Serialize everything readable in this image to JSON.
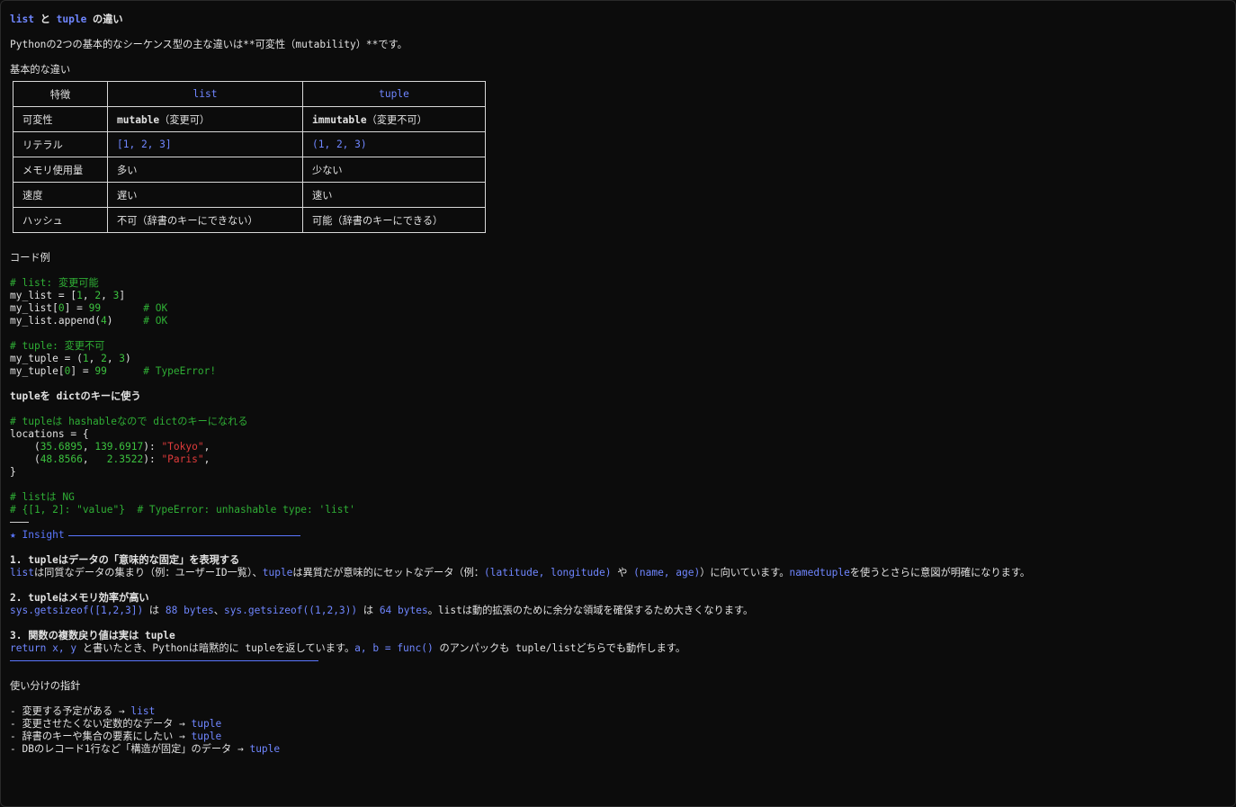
{
  "heading": {
    "list": "list",
    "and": " と ",
    "tuple": "tuple",
    "rest": " の違い"
  },
  "intro": "Pythonの2つの基本的なシーケンス型の主な違いは**可変性（mutability）**です。",
  "basic_title": "基本的な違い",
  "table": {
    "headers": [
      "特徴",
      "list",
      "tuple"
    ],
    "rows": [
      {
        "feature": "可変性",
        "list_bold": "mutable",
        "list_rest": "（変更可）",
        "tuple_bold": "immutable",
        "tuple_rest": "（変更不可）"
      },
      {
        "feature": "リテラル",
        "list": "[1, 2, 3]",
        "tuple": "(1, 2, 3)"
      },
      {
        "feature": "メモリ使用量",
        "list": "多い",
        "tuple": "少ない"
      },
      {
        "feature": "速度",
        "list": "遅い",
        "tuple": "速い"
      },
      {
        "feature": "ハッシュ",
        "list": "不可（辞書のキーにできない）",
        "tuple": "可能（辞書のキーにできる）"
      }
    ]
  },
  "code_example_title": "コード例",
  "code1": {
    "c1": "# list: 変更可能",
    "l1_a": "my_list = [",
    "l1_n1": "1",
    "l1_s1": ", ",
    "l1_n2": "2",
    "l1_s2": ", ",
    "l1_n3": "3",
    "l1_b": "]",
    "l2_a": "my_list[",
    "l2_n1": "0",
    "l2_b": "] = ",
    "l2_n2": "99",
    "l2_pad": "       ",
    "l2_c": "# OK",
    "l3_a": "my_list.append(",
    "l3_n": "4",
    "l3_b": ")",
    "l3_pad": "     ",
    "l3_c": "# OK",
    "c2": "# tuple: 変更不可",
    "l4_a": "my_tuple = (",
    "l4_n1": "1",
    "l4_s1": ", ",
    "l4_n2": "2",
    "l4_s2": ", ",
    "l4_n3": "3",
    "l4_b": ")",
    "l5_a": "my_tuple[",
    "l5_n1": "0",
    "l5_b": "] = ",
    "l5_n2": "99",
    "l5_pad": "      ",
    "l5_c": "# TypeError!"
  },
  "dict_key_title": "tupleを dictのキーに使う",
  "code2": {
    "c1": "# tupleは hashableなので dictのキーになれる",
    "l1": "locations = {",
    "l2_a": "    (",
    "l2_n1": "35.6895",
    "l2_s": ", ",
    "l2_n2": "139.6917",
    "l2_b": "): ",
    "l2_str": "\"Tokyo\"",
    "l2_e": ",",
    "l3_a": "    (",
    "l3_n1": "48.8566",
    "l3_s": ",   ",
    "l3_n2": "2.3522",
    "l3_b": "): ",
    "l3_str": "\"Paris\"",
    "l3_e": ",",
    "l4": "}",
    "c2": "# listは NG",
    "c3": "# {[1, 2]: \"value\"}  # TypeError: unhashable type: 'list'"
  },
  "separator": "---",
  "insight": {
    "title": "★ Insight",
    "p1_title": "1. tupleはデータの「意味的な固定」を表現する",
    "p1_k1": "list",
    "p1_t1": "は同質なデータの集まり（例：ユーザーID一覧）、",
    "p1_k2": "tuple",
    "p1_t2": "は異質だが意味的にセットなデータ（例：",
    "p1_k3": "(latitude, longitude)",
    "p1_t3": " や ",
    "p1_k4": "(name, age)",
    "p1_t4": "）に向いています。",
    "p1_k5": "namedtuple",
    "p1_t5": "を使うとさらに意図が明確になります。",
    "p2_title": "2. tupleはメモリ効率が高い",
    "p2_k1": "sys.getsizeof([1,2,3])",
    "p2_t1": " は ",
    "p2_k2": "88 bytes",
    "p2_t2": "、",
    "p2_k3": "sys.getsizeof((1,2,3))",
    "p2_t3": " は ",
    "p2_k4": "64 bytes",
    "p2_t4": "。listは動的拡張のために余分な領域を確保するため大きくなります。",
    "p3_title": "3. 関数の複数戻り値は実は tuple",
    "p3_k1": "return x, y",
    "p3_t1": " と書いたとき、Pythonは暗黙的に tupleを返しています。",
    "p3_k2": "a, b = func()",
    "p3_t2": " のアンパックも tuple/listどちらでも動作します。"
  },
  "usage": {
    "title": "使い分けの指針",
    "items": [
      {
        "text": "- 変更する予定がある → ",
        "target": "list"
      },
      {
        "text": "- 変更させたくない定数的なデータ → ",
        "target": "tuple"
      },
      {
        "text": "- 辞書のキーや集合の要素にしたい → ",
        "target": "tuple"
      },
      {
        "text": "- DBのレコード1行など「構造が固定」のデータ → ",
        "target": "tuple"
      }
    ]
  },
  "colors": {
    "background": "#0c0c0c",
    "text": "#e2e2e2",
    "keyword": "#6f86ff",
    "comment": "#2fae35",
    "number": "#3cc23f",
    "string": "#e03b3b",
    "accent": "#5b77ff"
  }
}
